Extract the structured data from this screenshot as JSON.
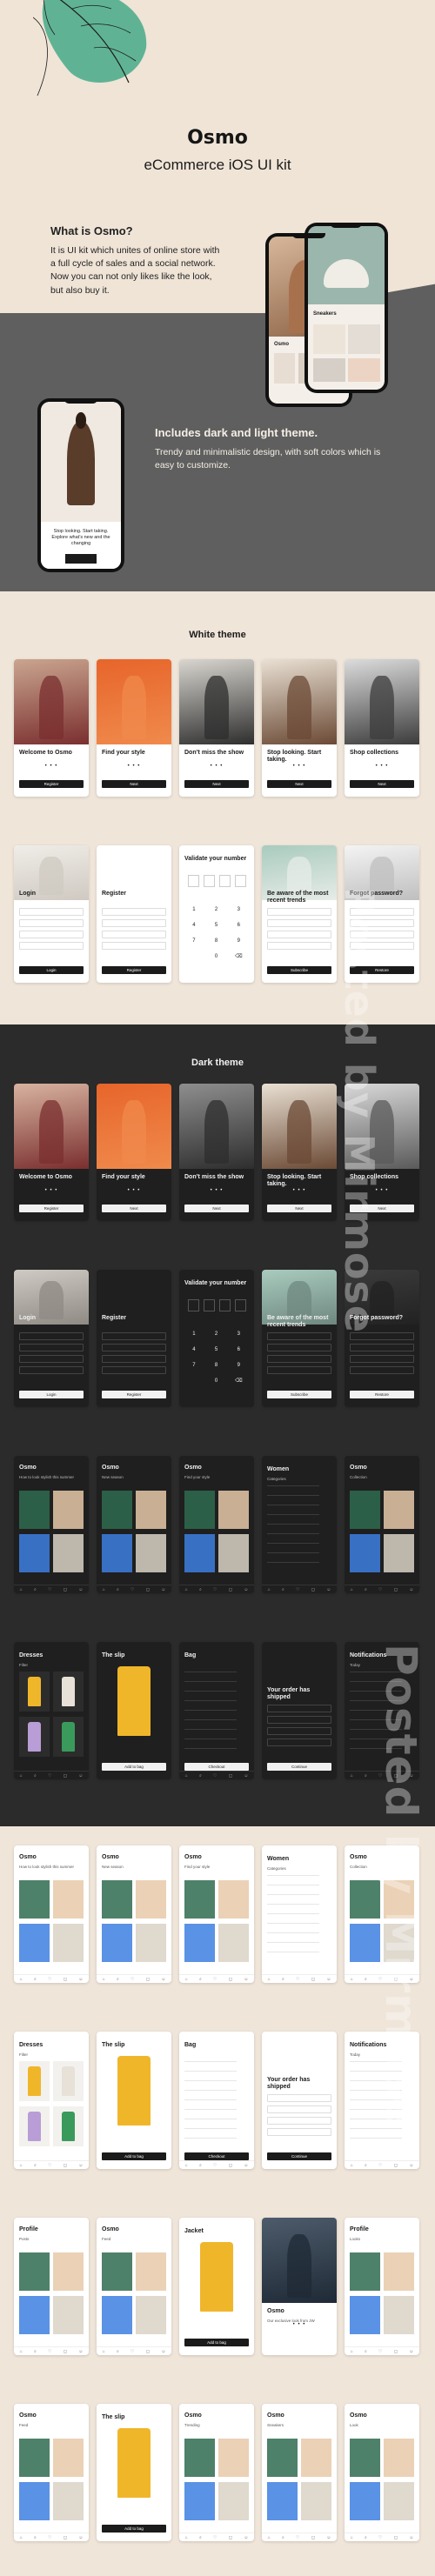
{
  "hero": {
    "brand": "Osmo",
    "subtitle": "eCommerce iOS UI kit",
    "what_title": "What is Osmo?",
    "what_text": "It is UI kit which unites of online store with a full cycle of sales and a social network. Now you can not only likes like the look, but also buy it.",
    "themes_title": "Includes dark and light theme.",
    "themes_text": "Trendy and minimalistic design, with soft colors which is easy to customize.",
    "phone_caption": "Stop looking. Start taking. Explore what’s new and the changing",
    "colors": {
      "bg": "#efe4d6",
      "grey": "#5f5f5f",
      "leaf": "#5fb394"
    }
  },
  "white_theme": {
    "title": "White theme",
    "row1": [
      {
        "title": "Welcome to Osmo",
        "button": "Register"
      },
      {
        "title": "Find your style",
        "button": "Next"
      },
      {
        "title": "Don’t miss the show",
        "button": "Next"
      },
      {
        "title": "Stop looking. Start taking.",
        "button": "Next"
      },
      {
        "title": "Shop collections",
        "button": "Next"
      }
    ],
    "row2": [
      {
        "title": "Login",
        "button": "Login"
      },
      {
        "title": "Register",
        "button": "Register"
      },
      {
        "title": "Validate your number",
        "keys": [
          "1",
          "2",
          "3",
          "4",
          "5",
          "6",
          "7",
          "8",
          "9",
          "",
          "0",
          "⌫"
        ]
      },
      {
        "title": "Be aware of the most recent trends",
        "button": "Subscribe"
      },
      {
        "title": "Forgot password?",
        "button": "Restore"
      }
    ]
  },
  "dark_theme": {
    "title": "Dark theme",
    "row1": [
      {
        "title": "Welcome to Osmo",
        "button": "Register"
      },
      {
        "title": "Find your style",
        "button": "Next"
      },
      {
        "title": "Don’t miss the show",
        "button": "Next"
      },
      {
        "title": "Stop looking. Start taking.",
        "button": "Next"
      },
      {
        "title": "Shop collections",
        "button": "Next"
      }
    ],
    "row2": [
      {
        "title": "Login",
        "button": "Login"
      },
      {
        "title": "Register",
        "button": "Register"
      },
      {
        "title": "Validate your number",
        "keys": [
          "1",
          "2",
          "3",
          "4",
          "5",
          "6",
          "7",
          "8",
          "9",
          "",
          "0",
          "⌫"
        ]
      },
      {
        "title": "Be aware of the most recent trends",
        "button": "Subscribe"
      },
      {
        "title": "Forgot password?",
        "button": "Restore"
      }
    ],
    "row3": [
      {
        "title": "Osmo",
        "subtitle": "How to look stylish this summer"
      },
      {
        "title": "Osmo",
        "subtitle": "New season"
      },
      {
        "title": "Osmo",
        "subtitle": "Find your style"
      },
      {
        "title": "Women",
        "subtitle": "Categories"
      },
      {
        "title": "Osmo",
        "subtitle": "Collection"
      }
    ],
    "row4": [
      {
        "title": "Dresses",
        "subtitle": "Filter"
      },
      {
        "title": "The slip",
        "button": "Add to bag"
      },
      {
        "title": "Bag",
        "button": "Checkout"
      },
      {
        "title": "Your order has shipped",
        "button": "Continue"
      },
      {
        "title": "Notifications",
        "subtitle": "Today"
      }
    ]
  },
  "light_more": {
    "row1": [
      {
        "title": "Osmo",
        "subtitle": "How to look stylish this summer"
      },
      {
        "title": "Osmo",
        "subtitle": "New season"
      },
      {
        "title": "Osmo",
        "subtitle": "Find your style"
      },
      {
        "title": "Women",
        "subtitle": "Categories"
      },
      {
        "title": "Osmo",
        "subtitle": "Collection"
      }
    ],
    "row2": [
      {
        "title": "Dresses",
        "subtitle": "Filter"
      },
      {
        "title": "The slip",
        "button": "Add to bag"
      },
      {
        "title": "Bag",
        "button": "Checkout"
      },
      {
        "title": "Your order has shipped",
        "button": "Continue"
      },
      {
        "title": "Notifications",
        "subtitle": "Today"
      }
    ],
    "row3": [
      {
        "title": "Profile",
        "subtitle": "Posts"
      },
      {
        "title": "Osmo",
        "subtitle": "Feed"
      },
      {
        "title": "Jacket",
        "button": "Add to bag"
      },
      {
        "title": "Osmo",
        "subtitle": "Our exclusive look from JW"
      },
      {
        "title": "Profile",
        "subtitle": "Looks"
      }
    ],
    "row4": [
      {
        "title": "Osmo",
        "subtitle": "Feed"
      },
      {
        "title": "The slip",
        "button": "Add to bag"
      },
      {
        "title": "Osmo",
        "subtitle": "Trending"
      },
      {
        "title": "Osmo",
        "subtitle": "Sneakers"
      },
      {
        "title": "Osmo",
        "subtitle": "Look"
      }
    ]
  },
  "watermark": "Posted by Mirmose"
}
